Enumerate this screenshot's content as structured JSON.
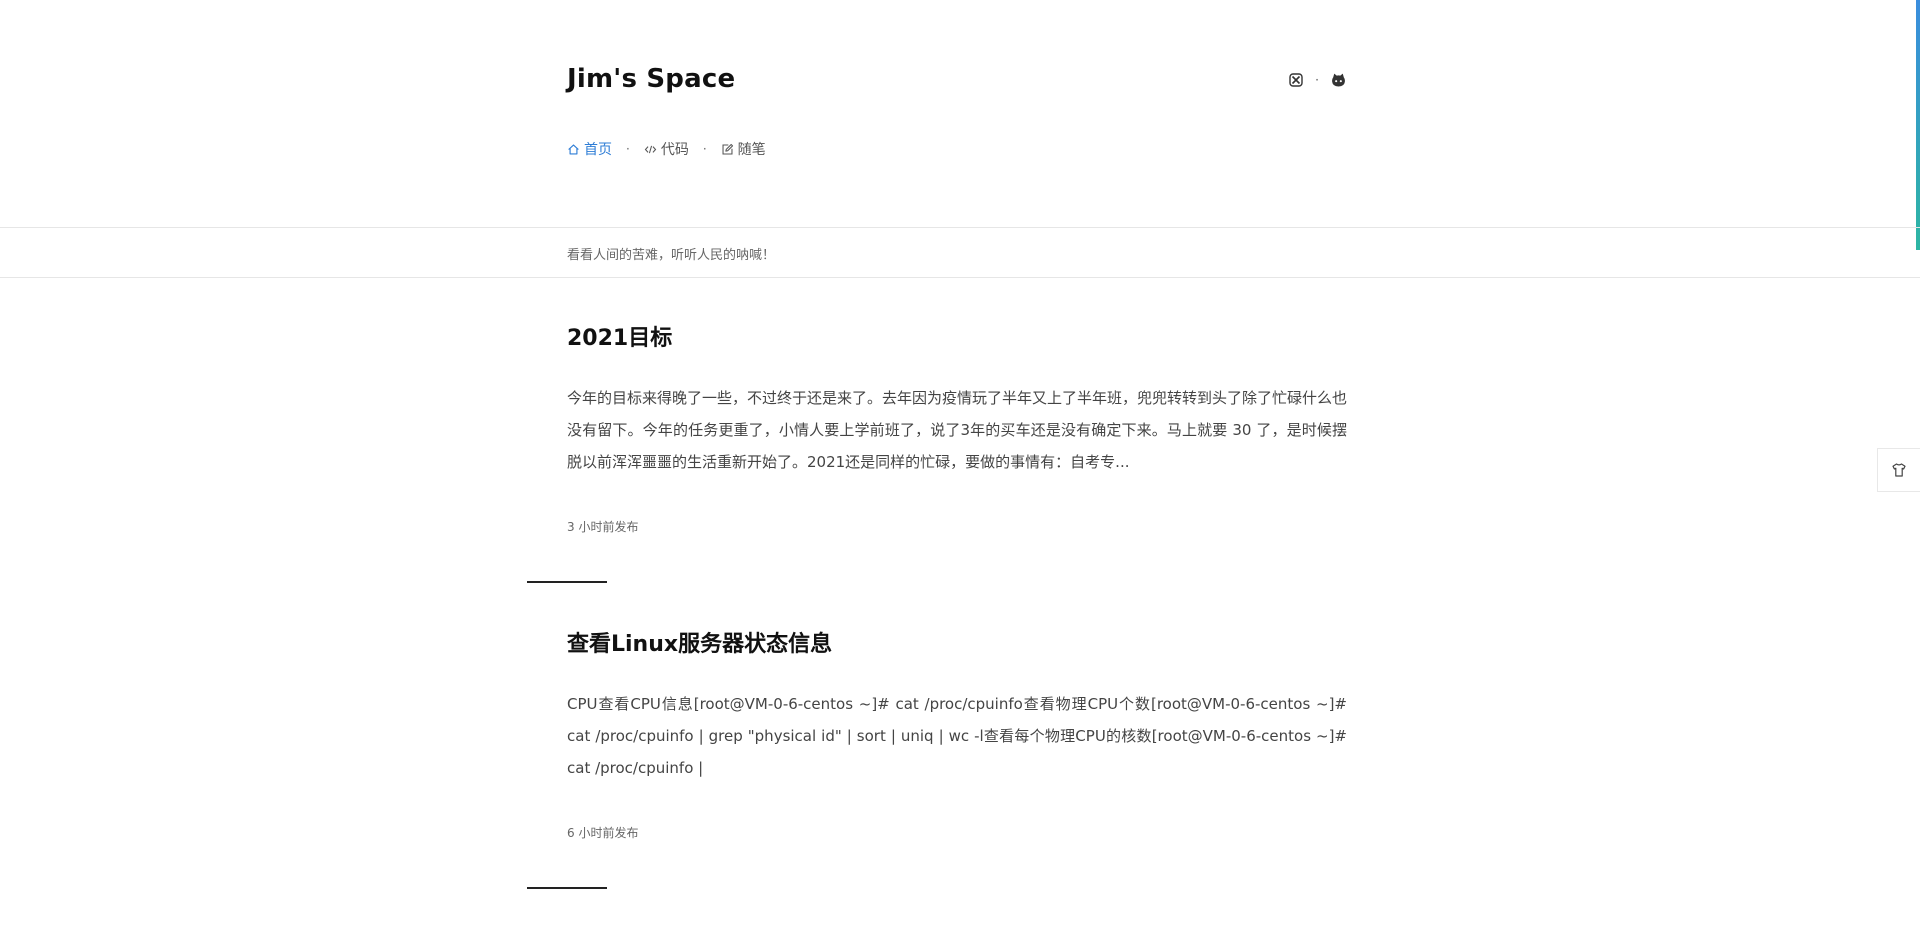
{
  "site": {
    "title": "Jim's Space",
    "slogan": "看看人间的苦难，听听人民的呐喊！"
  },
  "header_icons": {
    "left_icon": "close-badge-icon",
    "separator": "·",
    "right_icon": "github-icon"
  },
  "nav": {
    "items": [
      {
        "label": "首页",
        "icon": "home-icon",
        "active": true
      },
      {
        "label": "代码",
        "icon": "code-icon",
        "active": false
      },
      {
        "label": "随笔",
        "icon": "edit-icon",
        "active": false
      }
    ],
    "separator": "·"
  },
  "posts": [
    {
      "title": "2021目标",
      "excerpt": "今年的目标来得晚了一些，不过终于还是来了。去年因为疫情玩了半年又上了半年班，兜兜转转到头了除了忙碌什么也没有留下。今年的任务更重了，小情人要上学前班了，说了3年的买车还是没有确定下来。马上就要 30 了，是时候摆脱以前浑浑噩噩的生活重新开始了。2021还是同样的忙碌，要做的事情有：自考专...",
      "meta": "3 小时前发布"
    },
    {
      "title": "查看Linux服务器状态信息",
      "excerpt": "CPU查看CPU信息[root@VM-0-6-centos ~]# cat /proc/cpuinfo查看物理CPU个数[root@VM-0-6-centos ~]# cat /proc/cpuinfo | grep \"physical id\" | sort | uniq | wc -l查看每个物理CPU的核数[root@VM-0-6-centos ~]# cat /proc/cpuinfo |",
      "meta": "6 小时前发布"
    }
  ],
  "side_widget": {
    "icon": "shirt-icon"
  },
  "colors": {
    "accent": "#2e7dd6",
    "text": "#222222",
    "muted": "#666666"
  }
}
